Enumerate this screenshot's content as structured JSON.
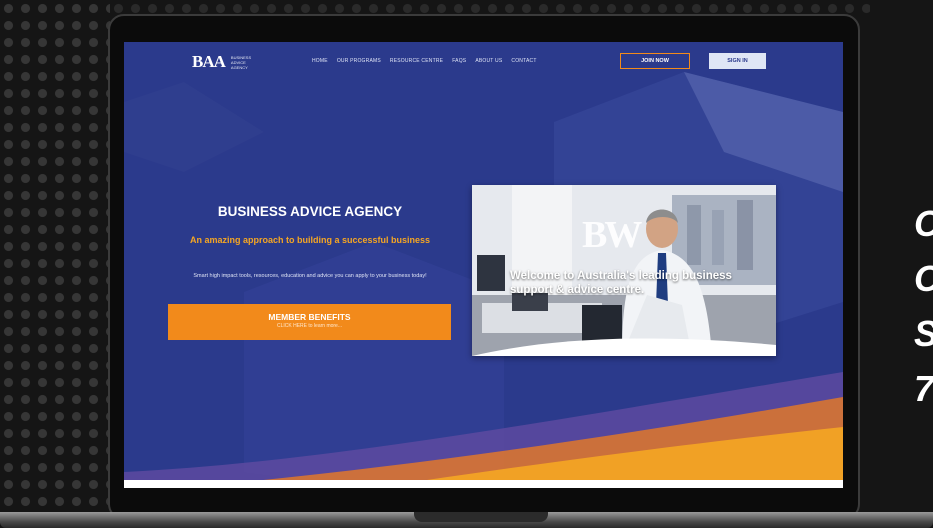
{
  "logo": {
    "mark": "BAA",
    "text": "BUSINESS ADVICE AGENCY"
  },
  "nav": {
    "items": [
      "HOME",
      "OUR PROGRAMS",
      "RESOURCE CENTRE",
      "FAQS",
      "ABOUT US",
      "CONTACT"
    ],
    "join_label": "JOIN NOW",
    "signin_label": "SIGN IN"
  },
  "hero": {
    "title": "BUSINESS ADVICE AGENCY",
    "subtitle": "An amazing approach to building a successful business",
    "body": "Smart high impact tools, resources, education and advice you can apply to your business today!",
    "cta_title": "MEMBER BENEFITS",
    "cta_sub": "CLICK HERE to learn more..."
  },
  "photo": {
    "logo": "BW",
    "caption": "Welcome to Australia's leading business support & advice centre."
  },
  "side_text": [
    "C",
    "C",
    "S",
    "7"
  ],
  "colors": {
    "brand_blue": "#2b3a8c",
    "accent_orange": "#f28a1b",
    "page_bg": "#151515"
  }
}
